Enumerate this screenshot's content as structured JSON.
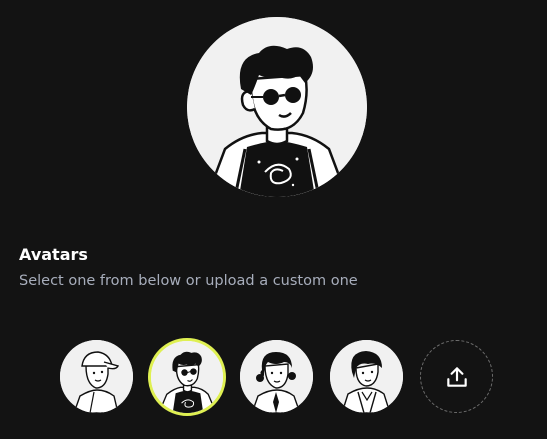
{
  "selected_avatar": {
    "icon": "avatar-man-sunglasses-icon"
  },
  "section": {
    "title": "Avatars",
    "subtitle": "Select one from below or upload a custom one"
  },
  "avatar_options": [
    {
      "icon": "avatar-man-cap-icon",
      "selected": false
    },
    {
      "icon": "avatar-man-sunglasses-icon",
      "selected": true
    },
    {
      "icon": "avatar-woman-tie-icon",
      "selected": false
    },
    {
      "icon": "avatar-woman-jacket-icon",
      "selected": false
    }
  ],
  "upload_button": {
    "icon": "upload-icon"
  },
  "colors": {
    "background": "#131313",
    "avatar_bg": "#f1f1f1",
    "selected_ring": "#dff052",
    "subtitle": "#a7adbb"
  }
}
